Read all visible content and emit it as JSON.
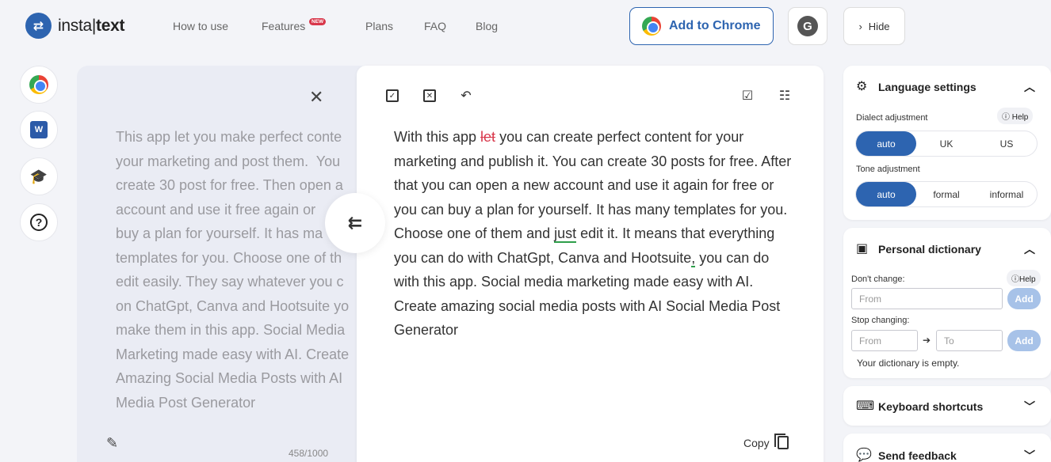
{
  "header": {
    "logo_text_left": "insta",
    "logo_text_right": "text",
    "nav": [
      "How to use",
      "Features",
      "Plans",
      "FAQ",
      "Blog"
    ],
    "new_badge": "NEW",
    "add_to_chrome": "Add to Chrome",
    "avatar_letter": "G",
    "hide_label": "Hide"
  },
  "source": {
    "text": "This app let you make perfect conte\nyour marketing and post them.  You\ncreate 30 post for free. Then open a\naccount and use it free again or\nbuy a plan for yourself. It has ma\ntemplates for you. Choose one of th\nedit easily. They say whatever you c\non ChatGpt, Canva and Hootsuite yo\nmake them in this app. Social Media\nMarketing made easy with AI. Create\nAmazing Social Media Posts with AI\nMedia Post Generator",
    "char_count": "458/1000"
  },
  "output": {
    "seg1": "With this app ",
    "deleted_word": "let",
    "seg2": " you can create perfect content for your marketing and publish it. You can create 30 posts for free. After that you can open a new account and use it again for free or you can buy a plan for yourself. It has many templates for you. Choose one of them and ",
    "highlight_word": "just",
    "seg3": " edit it. It means that everything you can do with ChatGpt, Canva and Hootsuite",
    "comma": ",",
    "seg4": " you can do with this app. Social media marketing made easy with AI. Create amazing social media posts with AI Social Media Post Generator",
    "copy_label": "Copy"
  },
  "language": {
    "title": "Language settings",
    "dialect_label": "Dialect adjustment",
    "help": "Help",
    "dialect_options": [
      "auto",
      "UK",
      "US"
    ],
    "tone_label": "Tone adjustment",
    "tone_options": [
      "auto",
      "formal",
      "informal"
    ]
  },
  "dictionary": {
    "title": "Personal dictionary",
    "dont_change_label": "Don't change:",
    "help": "Help",
    "from_placeholder": "From",
    "to_placeholder": "To",
    "add_label": "Add",
    "stop_changing_label": "Stop changing:",
    "empty_message": "Your dictionary is empty."
  },
  "shortcuts": {
    "title": "Keyboard shortcuts"
  },
  "feedback": {
    "title": "Send feedback"
  }
}
